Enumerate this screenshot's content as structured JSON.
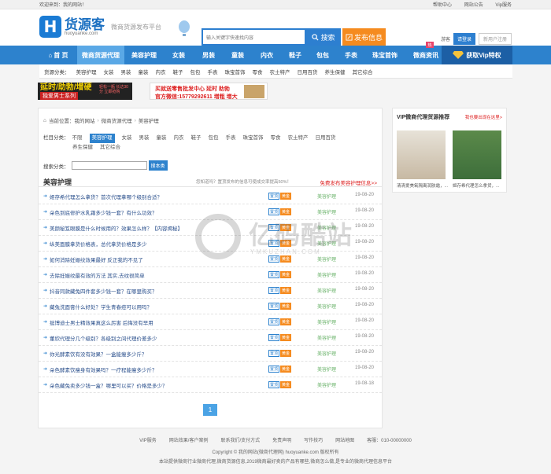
{
  "topbar": {
    "welcome": "欢迎来到：我的网站！",
    "links": [
      "帮助中心",
      "网站公告",
      "Vip服务"
    ]
  },
  "header": {
    "logo_letter": "H",
    "logo_name": "货源客",
    "logo_domain": "huoyuanke.com",
    "slogan": "微商货源发布平台",
    "search_placeholder": "输入关键字快速找内容",
    "search_button": "搜索",
    "publish_button": "发布信息",
    "guest_label": "游客",
    "login_button": "请登录",
    "register_button": "新用户注册"
  },
  "nav": {
    "items": [
      "首 页",
      "微商货源代理",
      "美容护理",
      "女装",
      "男装",
      "童装",
      "内衣",
      "鞋子",
      "包包",
      "手表",
      "珠宝首饰",
      "微商资讯"
    ],
    "vip": "获取Vip特权",
    "hot": "热"
  },
  "catbar": {
    "label": "货源分类：",
    "items": [
      "美容护理",
      "女装",
      "男装",
      "童装",
      "内衣",
      "鞋子",
      "包包",
      "手表",
      "珠宝首饰",
      "零食",
      "农土特产",
      "日用百货",
      "养生保健",
      "其它综合"
    ]
  },
  "banners": {
    "b1_line1": "延时/助勃/增硬",
    "b1_line2": "独爱男士系列",
    "b1_small": "轻松一瓶 长达30分 立即抢购",
    "b2_line1": "买就送零售批发中心  延时 助勃",
    "b2_line2": "官方微信:15779292611  增粗 增大"
  },
  "main": {
    "crumb": [
      "当前位置：我的网站",
      "微商货源代理",
      "美容护理"
    ],
    "filter_label": "栏目分类：",
    "filter_options": [
      "不限",
      "美容护理",
      "女装",
      "男装",
      "童装",
      "内衣",
      "鞋子",
      "包包",
      "手表",
      "珠宝首饰",
      "零食",
      "农土特产",
      "日用百货",
      "养生保健",
      "其它综合"
    ],
    "selected_option": "美容护理",
    "search_label": "搜索分类：",
    "search_button": "搜本类",
    "list_title": "美容护理",
    "list_note": "您知道吗？置顶发布的信息可使成交率提高50%！",
    "free_publish": "免费发布美容护理信息>>",
    "badge_yt": "置顶",
    "badge_vip": "黄金",
    "rows": [
      {
        "title": "姬存希代理怎么拿货？首次代理拿哪个级别合适？",
        "cat": "美容护理",
        "date": "19-08-20"
      },
      {
        "title": "朵色到底修护水乳霜多少钱一套？有什么功效？",
        "cat": "美容护理",
        "date": "19-08-20"
      },
      {
        "title": "美颜秘笈眼膜是什么时候用的？效果怎么样？【内容揭秘】",
        "cat": "美容护理",
        "date": "19-08-20"
      },
      {
        "title": "纵美面膜拿货价格表，总代拿货价格是多少",
        "cat": "美容护理",
        "date": "19-08-20"
      },
      {
        "title": "如何消除妊娠纹效果最好 反正我的不见了",
        "cat": "美容护理",
        "date": "19-08-20"
      },
      {
        "title": "去除妊娠纹最有效的方法 其实,去纹很简单",
        "cat": "美容护理",
        "date": "19-08-20"
      },
      {
        "title": "抖音同款藏兔四件套多少钱一套？在哪里购买？",
        "cat": "美容护理",
        "date": "19-08-20"
      },
      {
        "title": "藏兔洗面膏什么好处？学生青春痘可以用吗？",
        "cat": "美容护理",
        "date": "19-08-20"
      },
      {
        "title": "挺博迪士男士精效果真这么厉害 后悔没有早用",
        "cat": "美容护理",
        "date": "19-08-20"
      },
      {
        "title": "董欣代理分几个级别？各级别之间代理价差多少",
        "cat": "美容护理",
        "date": "19-08-20"
      },
      {
        "title": "你光酵素饮有没有效果？一盒能瘦多少斤？",
        "cat": "美容护理",
        "date": "19-08-20"
      },
      {
        "title": "朵色酵素饮瘦身有效果吗？一疗程能瘦多少斤？",
        "cat": "美容护理",
        "date": "19-08-20"
      },
      {
        "title": "朵色藏兔卖多少钱一盒？哪里可以买？价格是多少？",
        "cat": "美容护理",
        "date": "19-08-18"
      }
    ],
    "page": "1"
  },
  "side": {
    "title": "VIP微商代理货源推荐",
    "more": "我也要出现在这里>",
    "cap1": "清清爱美氧隔离润肤霜，...",
    "cap2": "姬存希代理怎么拿货，..."
  },
  "watermark": {
    "cn": "亿码酷站",
    "en": "YMKUZHAN.COM"
  },
  "footer": {
    "links": [
      "VIP服务",
      "网站效果/客户案例",
      "联系我们/支付方式",
      "免责声明",
      "写作技巧",
      "网站地图",
      "客服：010-00000000"
    ],
    "copyright": "Copyright © 我的网站(微商代理网) huoyuanke.com 版权所有",
    "desc": "本站提供微商行业微商代理,微商货源信息,2019微商最好卖的产品有哪些,微商怎么做,是专业的微商代理信息平台"
  }
}
